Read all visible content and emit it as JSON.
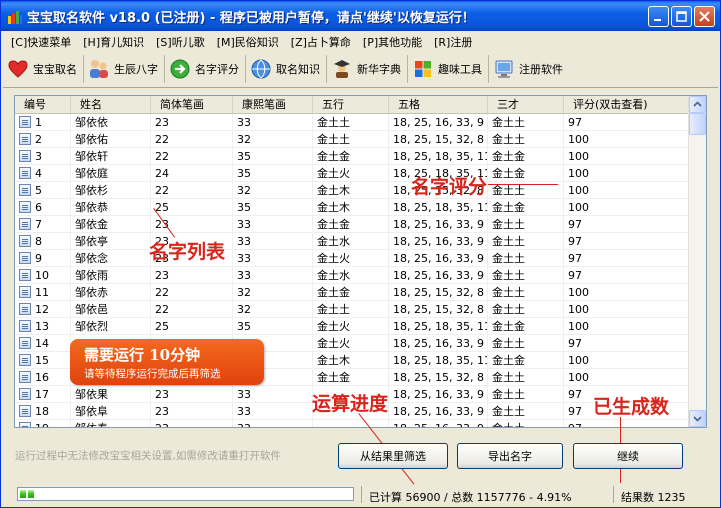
{
  "window": {
    "title": "宝宝取名软件 v18.0 (已注册) - 程序已被用户暂停，请点'继续'以恢复运行！"
  },
  "menu": [
    {
      "label": "[C]快速菜单"
    },
    {
      "label": "[H]育儿知识"
    },
    {
      "label": "[S]听儿歌"
    },
    {
      "label": "[M]民俗知识"
    },
    {
      "label": "[Z]占卜算命"
    },
    {
      "label": "[P]其他功能"
    },
    {
      "label": "[R]注册"
    }
  ],
  "toolbar": [
    {
      "label": "宝宝取名",
      "icon": "heart-icon"
    },
    {
      "label": "生辰八字",
      "icon": "people-icon"
    },
    {
      "label": "名字评分",
      "icon": "arrow-circle-icon"
    },
    {
      "label": "取名知识",
      "icon": "globe-icon"
    },
    {
      "label": "新华字典",
      "icon": "scholar-icon"
    },
    {
      "label": "趣味工具",
      "icon": "windows-logo-icon"
    },
    {
      "label": "注册软件",
      "icon": "computer-icon"
    }
  ],
  "table": {
    "columns": [
      "编号",
      "姓名",
      "简体笔画",
      "康熙笔画",
      "五行",
      "五格",
      "三才",
      "评分(双击查看)"
    ],
    "rows": [
      [
        "1",
        "邹依依",
        "23",
        "33",
        "金土土",
        "18, 25, 16, 33, 9",
        "金土土",
        "97"
      ],
      [
        "2",
        "邹依佑",
        "22",
        "32",
        "金土土",
        "18, 25, 15, 32, 8",
        "金土土",
        "100"
      ],
      [
        "3",
        "邹依轩",
        "22",
        "35",
        "金土金",
        "18, 25, 18, 35, 11",
        "金土金",
        "100"
      ],
      [
        "4",
        "邹依庭",
        "24",
        "35",
        "金土火",
        "18, 25, 18, 35, 11",
        "金土金",
        "100"
      ],
      [
        "5",
        "邹依杉",
        "22",
        "32",
        "金土木",
        "18, 25, 15, 32, 8",
        "金土土",
        "100"
      ],
      [
        "6",
        "邹依恭",
        "25",
        "35",
        "金土木",
        "18, 25, 18, 35, 11",
        "金土金",
        "100"
      ],
      [
        "7",
        "邹依金",
        "23",
        "33",
        "金土金",
        "18, 25, 16, 33, 9",
        "金土土",
        "97"
      ],
      [
        "8",
        "邹依亭",
        "23",
        "33",
        "金土水",
        "18, 25, 16, 33, 9",
        "金土土",
        "97"
      ],
      [
        "9",
        "邹依念",
        "23",
        "33",
        "金土火",
        "18, 25, 16, 33, 9",
        "金土土",
        "97"
      ],
      [
        "10",
        "邹依雨",
        "23",
        "33",
        "金土水",
        "18, 25, 16, 33, 9",
        "金土土",
        "97"
      ],
      [
        "11",
        "邹依赤",
        "22",
        "32",
        "金土金",
        "18, 25, 15, 32, 8",
        "金土土",
        "100"
      ],
      [
        "12",
        "邹依邑",
        "22",
        "32",
        "金土土",
        "18, 25, 15, 32, 8",
        "金土土",
        "100"
      ],
      [
        "13",
        "邹依烈",
        "25",
        "35",
        "金土火",
        "18, 25, 18, 35, 11",
        "金土金",
        "100"
      ],
      [
        "14",
        "",
        "",
        "",
        "金土火",
        "18, 25, 16, 33, 9",
        "金土土",
        "97"
      ],
      [
        "15",
        "",
        "",
        "",
        "金土木",
        "18, 25, 18, 35, 11",
        "金土金",
        "100"
      ],
      [
        "16",
        "",
        "",
        "",
        "金土金",
        "18, 25, 15, 32, 8",
        "金土土",
        "100"
      ],
      [
        "17",
        "邹依果",
        "23",
        "33",
        "",
        "18, 25, 16, 33, 9",
        "金土土",
        "97"
      ],
      [
        "18",
        "邹依阜",
        "23",
        "33",
        "",
        "18, 25, 16, 33, 9",
        "金土土",
        "97"
      ],
      [
        "19",
        "邹依奉",
        "23",
        "33",
        "",
        "18, 25, 16, 33, 9",
        "金土土",
        "97"
      ]
    ]
  },
  "annotations": {
    "name_list": "名字列表",
    "name_score": "名字评分",
    "progress": "运算进度",
    "generated_count": "已生成数",
    "notice_title": "需要运行 10分钟",
    "notice_sub": "请等待程序运行完成后再筛选"
  },
  "bottom": {
    "hint": "运行过程中无法修改宝宝相关设置,如需修改请重打开软件",
    "filter_button": "从结果里筛选",
    "export_button": "导出名字",
    "continue_button": "继续"
  },
  "status": {
    "computed": "已计算 56900 / 总数 1157776 - 4.91%",
    "results": "结果数 1235",
    "progress_percent": 4.91
  },
  "colors": {
    "title_bar": "#0A5FEA",
    "annotation_red": "#D8241A",
    "notice_orange": "#F46A1F"
  }
}
